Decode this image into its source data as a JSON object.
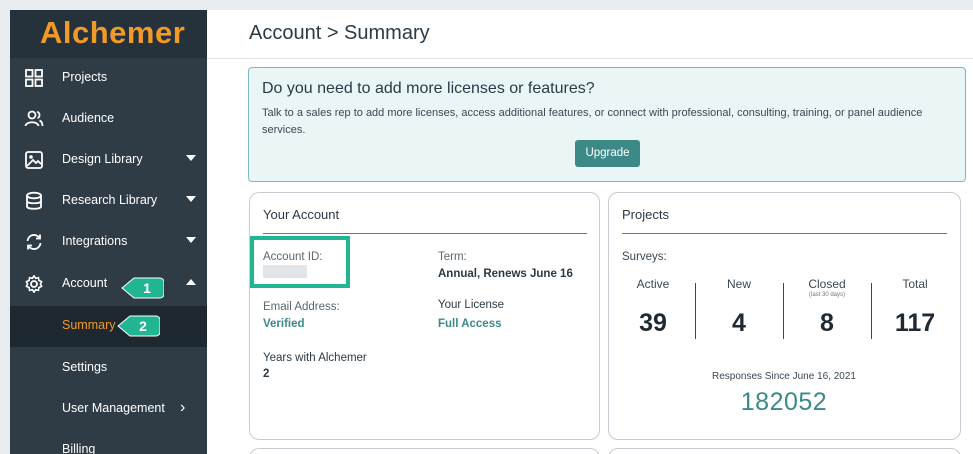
{
  "sidebar": {
    "logo": "Alchemer",
    "items": [
      {
        "label": "Projects",
        "icon": "grid-icon"
      },
      {
        "label": "Audience",
        "icon": "users-icon"
      },
      {
        "label": "Design Library",
        "icon": "image-icon"
      },
      {
        "label": "Research Library",
        "icon": "database-icon"
      },
      {
        "label": "Integrations",
        "icon": "refresh-icon"
      },
      {
        "label": "Account",
        "icon": "gear-icon"
      }
    ],
    "sub_items": [
      {
        "label": "Summary"
      },
      {
        "label": "Settings"
      },
      {
        "label": "User Management"
      },
      {
        "label": "Billing"
      }
    ],
    "callouts": [
      "1",
      "2"
    ]
  },
  "header": {
    "title": "Account > Summary"
  },
  "banner": {
    "title": "Do you need to add more licenses or features?",
    "text": "Talk to a sales rep to add more licenses, access additional features, or connect with professional, consulting, training, or panel audience services.",
    "button": "Upgrade"
  },
  "account_card": {
    "title": "Your Account",
    "account_id_label": "Account ID:",
    "term_label": "Term:",
    "term_value": "Annual, Renews June 16",
    "email_label": "Email Address:",
    "email_value": "Verified",
    "license_label": "Your License",
    "license_value": "Full Access",
    "years_label": "Years with Alchemer",
    "years_value": "2"
  },
  "projects_card": {
    "title": "Projects",
    "surveys_label": "Surveys:",
    "stats": [
      {
        "label": "Active",
        "sub": "",
        "value": "39"
      },
      {
        "label": "New",
        "sub": "",
        "value": "4"
      },
      {
        "label": "Closed",
        "sub": "(last 30 days)",
        "value": "8"
      },
      {
        "label": "Total",
        "sub": "",
        "value": "117"
      }
    ],
    "responses_label": "Responses Since June 16, 2021",
    "responses_value": "182052"
  },
  "colors": {
    "accent": "#f29a27",
    "teal": "#3b8a88",
    "callout": "#22b594",
    "sidebar": "#2f3c46"
  }
}
